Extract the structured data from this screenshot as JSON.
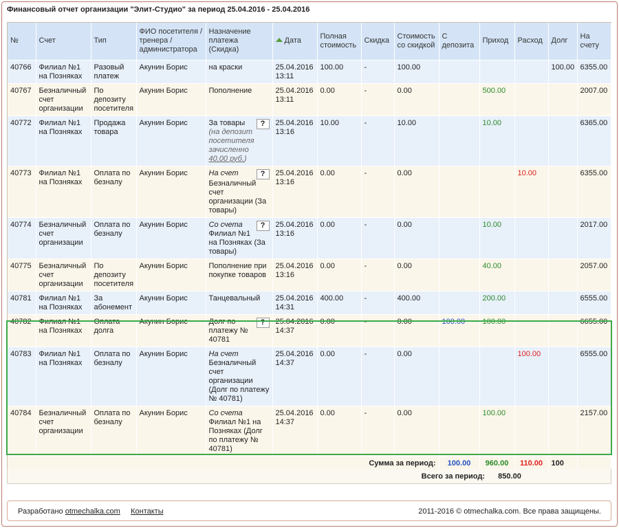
{
  "title": "Финансовый отчет организации \"Элит-Студио\" за период 25.04.2016 - 25.04.2016",
  "headers": {
    "num": "№",
    "account": "Счет",
    "type": "Тип",
    "person": "ФИО посетителя / тренера / администратора",
    "purpose": "Назначение платежа (Скидка)",
    "date": "Дата",
    "full_price": "Полная стоимость",
    "discount": "Скидка",
    "discounted": "Стоимость со скидкой",
    "from_deposit": "С депозита",
    "income": "Приход",
    "expense": "Расход",
    "debt": "Долг",
    "balance": "На счету"
  },
  "rows": [
    {
      "num": "40766",
      "account": "Филиал №1 на Позняках",
      "type": "Разовый платеж",
      "person": "Акунин Борис",
      "purpose": "на краски",
      "purpose_italic": false,
      "has_q": false,
      "note": "",
      "note_amount": "",
      "note_after": "",
      "date": "25.04.2016 13:11",
      "full": "100.00",
      "disc": "-",
      "disc_price": "100.00",
      "deposit": "",
      "income": "",
      "expense": "",
      "debt": "100.00",
      "balance": "6355.00"
    },
    {
      "num": "40767",
      "account": "Безналичный счет организации",
      "type": "По депозиту посетителя",
      "person": "Акунин Борис",
      "purpose": "Пополнение",
      "purpose_italic": false,
      "has_q": false,
      "note": "",
      "note_amount": "",
      "note_after": "",
      "date": "25.04.2016 13:11",
      "full": "0.00",
      "disc": "-",
      "disc_price": "0.00",
      "deposit": "",
      "income": "500.00",
      "expense": "",
      "debt": "",
      "balance": "2007.00"
    },
    {
      "num": "40772",
      "account": "Филиал №1 на Позняках",
      "type": "Продажа товара",
      "person": "Акунин Борис",
      "purpose": "За товары",
      "purpose_italic": false,
      "has_q": true,
      "note": "(на депозит посетителя зачисленно ",
      "note_amount": "40.00 руб.",
      "note_after": ")",
      "date": "25.04.2016 13:16",
      "full": "10.00",
      "disc": "-",
      "disc_price": "10.00",
      "deposit": "",
      "income": "10.00",
      "expense": "",
      "debt": "",
      "balance": "6365.00"
    },
    {
      "num": "40773",
      "account": "Филиал №1 на Позняках",
      "type": "Оплата по безналу",
      "person": "Акунин Борис",
      "purpose_pre": "На счет",
      "purpose": "Безналичный счет организации (За товары)",
      "purpose_italic": true,
      "has_q": true,
      "note": "",
      "note_amount": "",
      "note_after": "",
      "date": "25.04.2016 13:16",
      "full": "0.00",
      "disc": "-",
      "disc_price": "0.00",
      "deposit": "",
      "income": "",
      "expense": "10.00",
      "debt": "",
      "balance": "6355.00"
    },
    {
      "num": "40774",
      "account": "Безналичный счет организации",
      "type": "Оплата по безналу",
      "person": "Акунин Борис",
      "purpose_pre": "Со счета",
      "purpose": "Филиал №1 на Позняках (За товары)",
      "purpose_italic": true,
      "has_q": true,
      "note": "",
      "note_amount": "",
      "note_after": "",
      "date": "25.04.2016 13:16",
      "full": "0.00",
      "disc": "-",
      "disc_price": "0.00",
      "deposit": "",
      "income": "10.00",
      "expense": "",
      "debt": "",
      "balance": "2017.00"
    },
    {
      "num": "40775",
      "account": "Безналичный счет организации",
      "type": "По депозиту посетителя",
      "person": "Акунин Борис",
      "purpose": "Пополнение при покупке товаров",
      "purpose_italic": false,
      "has_q": false,
      "note": "",
      "note_amount": "",
      "note_after": "",
      "date": "25.04.2016 13:16",
      "full": "0.00",
      "disc": "-",
      "disc_price": "0.00",
      "deposit": "",
      "income": "40.00",
      "expense": "",
      "debt": "",
      "balance": "2057.00"
    },
    {
      "num": "40781",
      "account": "Филиал №1 на Позняках",
      "type": "За абонемент",
      "person": "Акунин Борис",
      "purpose": "Танцевальный",
      "purpose_italic": false,
      "has_q": false,
      "note": "",
      "note_amount": "",
      "note_after": "",
      "date": "25.04.2016 14:31",
      "full": "400.00",
      "disc": "-",
      "disc_price": "400.00",
      "deposit": "",
      "income": "200.00",
      "expense": "",
      "debt": "",
      "balance": "6555.00"
    },
    {
      "num": "40782",
      "account": "Филиал №1 на Позняках",
      "type": "Оплата долга",
      "person": "Акунин Борис",
      "purpose": "Долг по платежу № 40781",
      "purpose_italic": false,
      "has_q": true,
      "note": "",
      "note_amount": "",
      "note_after": "",
      "date": "25.04.2016 14:37",
      "full": "0.00",
      "disc": "-",
      "disc_price": "0.00",
      "deposit": "100.00",
      "income": "100.00",
      "expense": "",
      "debt": "",
      "balance": "6655.00"
    },
    {
      "num": "40783",
      "account": "Филиал №1 на Позняках",
      "type": "Оплата по безналу",
      "person": "Акунин Борис",
      "purpose_pre": "На счет",
      "purpose": "Безналичный счет организации (Долг по платежу № 40781)",
      "purpose_italic": true,
      "has_q": false,
      "note": "",
      "note_amount": "",
      "note_after": "",
      "date": "25.04.2016 14:37",
      "full": "0.00",
      "disc": "-",
      "disc_price": "0.00",
      "deposit": "",
      "income": "",
      "expense": "100.00",
      "debt": "",
      "balance": "6555.00"
    },
    {
      "num": "40784",
      "account": "Безналичный счет организации",
      "type": "Оплата по безналу",
      "person": "Акунин Борис",
      "purpose_pre": "Со счета",
      "purpose": "Филиал №1 на Позняках (Долг по платежу № 40781)",
      "purpose_italic": true,
      "has_q": false,
      "note": "",
      "note_amount": "",
      "note_after": "",
      "date": "25.04.2016 14:37",
      "full": "0.00",
      "disc": "-",
      "disc_price": "0.00",
      "deposit": "",
      "income": "100.00",
      "expense": "",
      "debt": "",
      "balance": "2157.00"
    }
  ],
  "summary": {
    "label": "Сумма за период:",
    "deposit": "100.00",
    "income": "960.00",
    "expense": "110.00",
    "debt": "100"
  },
  "total": {
    "label": "Всего за период:",
    "value": "850.00"
  },
  "footer": {
    "developed": "Разработано",
    "site_link": "otmechalka.com",
    "contacts_link": "Контакты",
    "copyright": "2011-2016 © otmechalka.com. Все права защищены."
  },
  "colors": {
    "header_bg": "#d4e4f6",
    "row_blue": "#e8f0fa",
    "row_cream": "#fbf6ea",
    "income": "#2a8a2a",
    "expense": "#e02020",
    "deposit": "#2050c0",
    "highlight_border": "#3aaa4a"
  }
}
